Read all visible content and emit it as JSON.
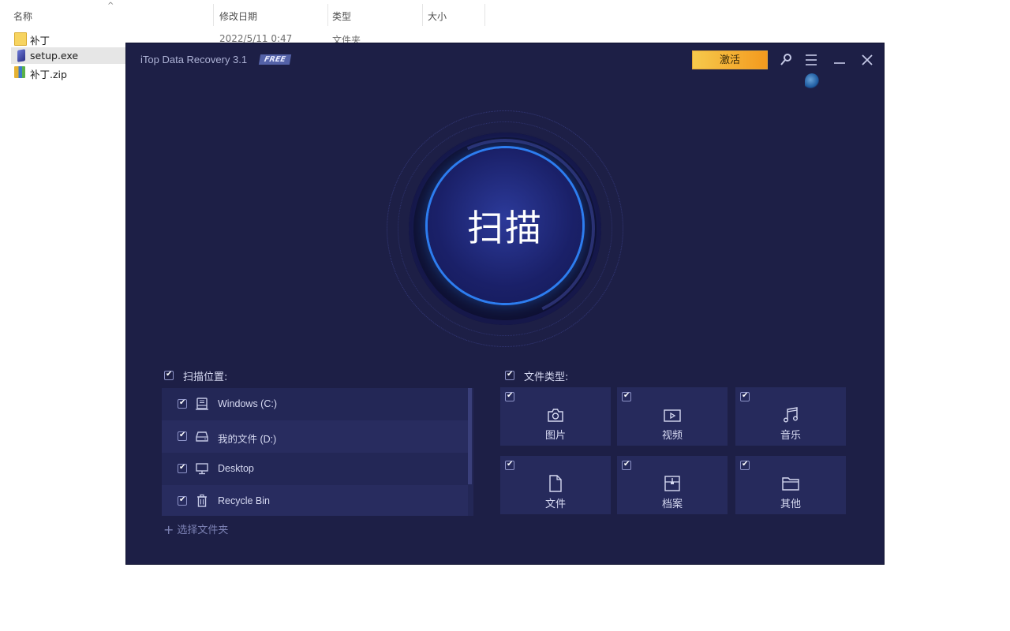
{
  "explorer": {
    "columns": {
      "name": "名称",
      "modified": "修改日期",
      "type": "类型",
      "size": "大小"
    },
    "files": [
      {
        "name": "补丁",
        "modified": "2022/5/11 0:47",
        "type": "文件夹",
        "icon": "folder-icon"
      },
      {
        "name": "setup.exe",
        "icon": "exe-icon"
      },
      {
        "name": "补丁.zip",
        "icon": "zip-icon"
      }
    ]
  },
  "app": {
    "title": "iTop Data Recovery 3.1",
    "badge": "FREE",
    "activate_label": "激活",
    "scan_label": "扫描",
    "locations_label": "扫描位置:",
    "locations": [
      {
        "label": "Windows (C:)",
        "icon": "hard-drive-icon",
        "checked": true
      },
      {
        "label": "我的文件 (D:)",
        "icon": "drive-icon",
        "checked": true
      },
      {
        "label": "Desktop",
        "icon": "monitor-icon",
        "checked": true
      },
      {
        "label": "Recycle Bin",
        "icon": "trash-icon",
        "checked": true
      }
    ],
    "add_folder_label": "选择文件夹",
    "filetypes_label": "文件类型:",
    "filetypes": [
      {
        "label": "图片",
        "icon": "camera-icon",
        "checked": true
      },
      {
        "label": "视频",
        "icon": "video-icon",
        "checked": true
      },
      {
        "label": "音乐",
        "icon": "music-icon",
        "checked": true
      },
      {
        "label": "文件",
        "icon": "document-icon",
        "checked": true
      },
      {
        "label": "档案",
        "icon": "archive-icon",
        "checked": true
      },
      {
        "label": "其他",
        "icon": "folder-icon",
        "checked": true
      }
    ],
    "colors": {
      "background": "#1d1f46",
      "accent": "#2d7df0",
      "activate": "#f6c94c"
    }
  }
}
